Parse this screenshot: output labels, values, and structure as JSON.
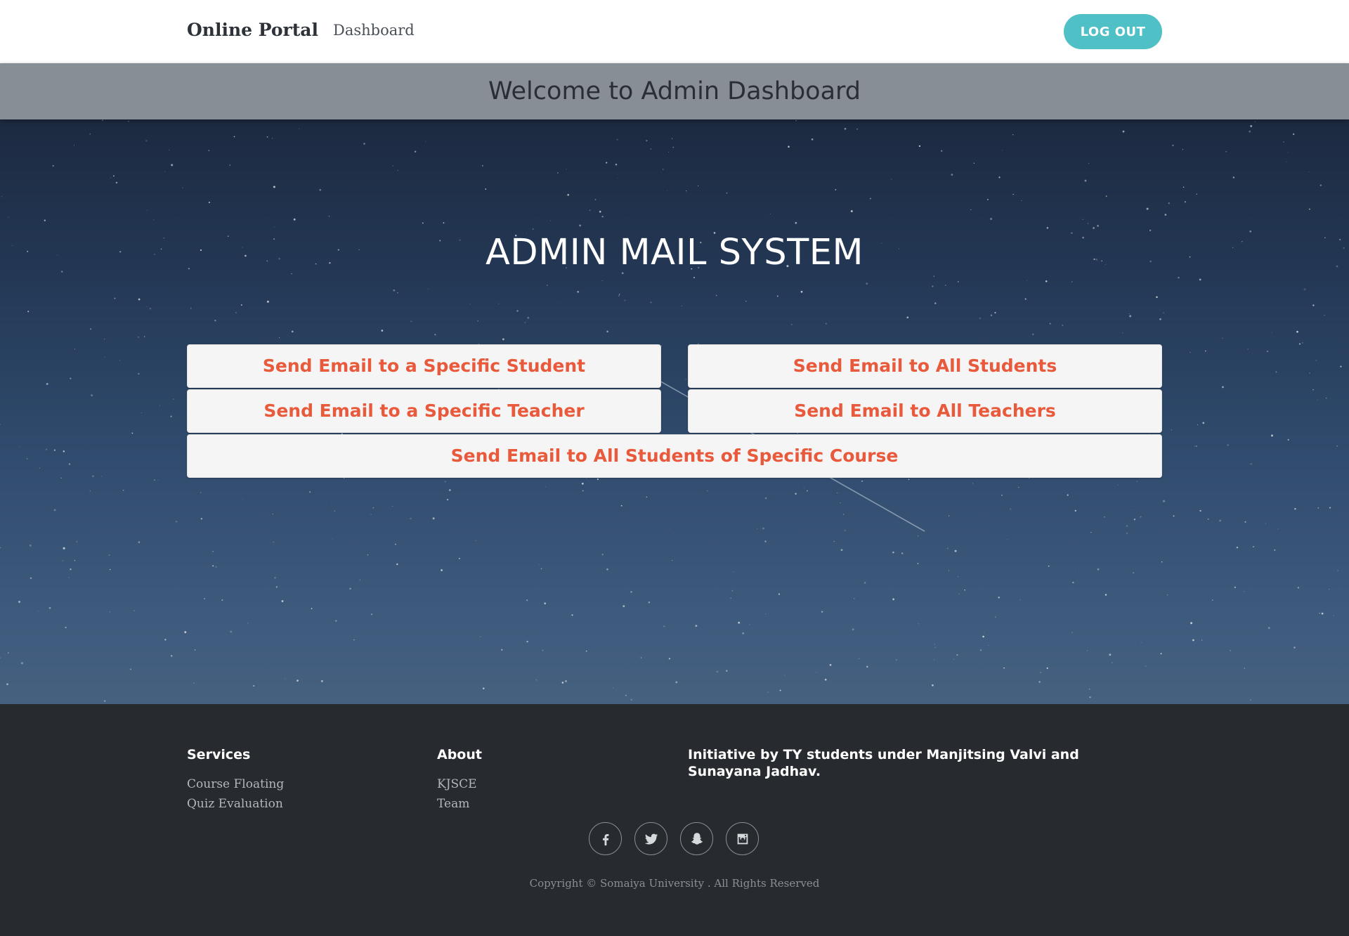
{
  "navbar": {
    "brand": "Online Portal",
    "dashboard_link": "Dashboard",
    "logout_label": "LOG OUT"
  },
  "welcome": {
    "title": "Welcome to Admin Dashboard"
  },
  "hero": {
    "title": "ADMIN MAIL SYSTEM",
    "buttons": {
      "specific_student": "Send Email to a Specific Student",
      "all_students": "Send Email to All Students",
      "specific_teacher": "Send Email to a Specific Teacher",
      "all_teachers": "Send Email to All Teachers",
      "course_students": "Send Email to All Students of Specific Course"
    }
  },
  "footer": {
    "services": {
      "heading": "Services",
      "items": [
        "Course Floating",
        "Quiz Evaluation"
      ]
    },
    "about": {
      "heading": "About",
      "items": [
        "KJSCE",
        "Team"
      ]
    },
    "initiative": "Initiative by TY students under Manjitsing Valvi and Sunayana Jadhav.",
    "social": [
      "facebook-icon",
      "twitter-icon",
      "snapchat-icon",
      "instagram-icon"
    ],
    "copyright": "Copyright © Somaiya University . All Rights Reserved"
  },
  "colors": {
    "accent_teal": "#4fc0c5",
    "button_text": "#e85a3b",
    "footer_bg": "#272b30",
    "welcome_band": "#878e95"
  }
}
